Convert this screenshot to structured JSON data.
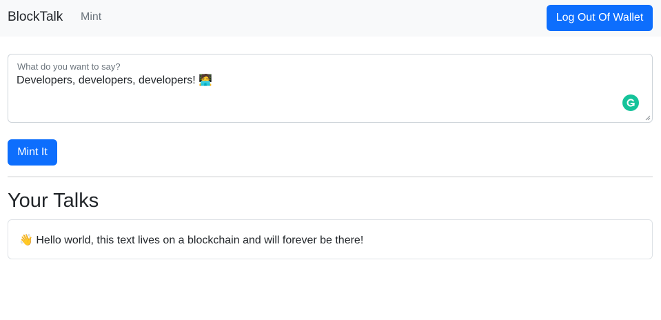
{
  "navbar": {
    "brand": "BlockTalk",
    "nav_link": "Mint",
    "logout_label": "Log Out Of Wallet"
  },
  "composer": {
    "label": "What do you want to say?",
    "value": "Developers, developers, developers! 🧑‍💻",
    "mint_label": "Mint It"
  },
  "talks": {
    "title": "Your Talks",
    "items": [
      {
        "text": "👋 Hello world, this text lives on a blockchain and will forever be there!"
      }
    ]
  },
  "colors": {
    "primary": "#0d6efd",
    "navbar_bg": "#f8f9fa",
    "grammarly": "#15c39a"
  },
  "icons": {
    "grammarly": "grammarly-icon"
  }
}
